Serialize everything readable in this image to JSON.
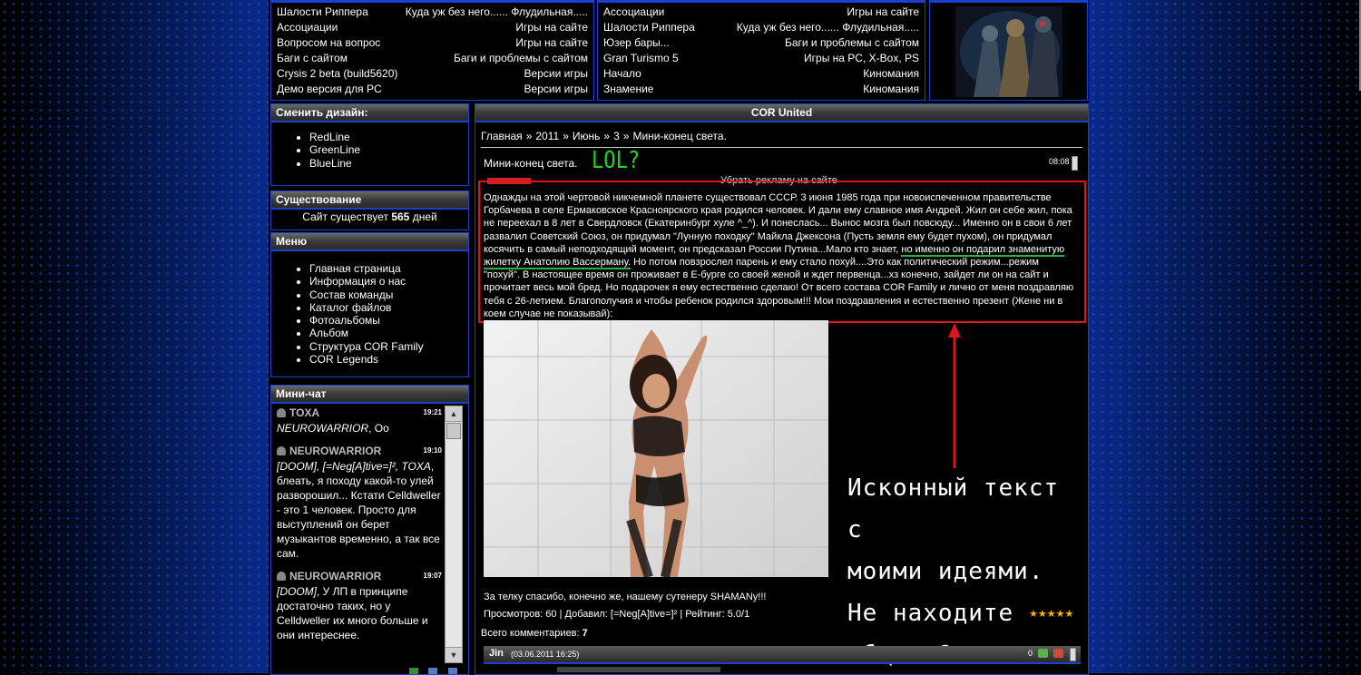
{
  "top_left_box": {
    "rows": [
      {
        "left": "Шалости Риппера",
        "right": "Куда уж без него...... Флудильная....."
      },
      {
        "left": "Ассоциации",
        "right": "Игры на сайте"
      },
      {
        "left": "Вопросом на вопрос",
        "right": "Игры на сайте"
      },
      {
        "left": "Баги с сайтом",
        "right": "Баги и проблемы с сайтом"
      },
      {
        "left": "Crysis 2 beta (build5620)",
        "right": "Версии игры"
      },
      {
        "left": "Демо версия для PC",
        "right": "Версии игры"
      }
    ]
  },
  "top_mid_box": {
    "rows": [
      {
        "left": "Ассоциации",
        "right": "Игры на сайте"
      },
      {
        "left": "Шалости Риппера",
        "right": "Куда уж без него...... Флудильная....."
      },
      {
        "left": "Юзер бары...",
        "right": "Баги и проблемы с сайтом"
      },
      {
        "left": "Gran Turismo 5",
        "right": "Игры на PC, X-Box, PS"
      },
      {
        "left": "Начало",
        "right": "Киномания"
      },
      {
        "left": "Знамение",
        "right": "Киномания"
      }
    ]
  },
  "design_box": {
    "title": "Сменить дизайн:",
    "items": [
      "RedLine",
      "GreenLine",
      "BlueLine"
    ]
  },
  "existence_box": {
    "title": "Существование",
    "prefix": "Сайт существует",
    "days": "565",
    "suffix": "дней"
  },
  "menu_box": {
    "title": "Меню",
    "items": [
      "Главная страница",
      "Информация о нас",
      "Состав команды",
      "Каталог файлов",
      "Фотоальбомы",
      "Альбом",
      "Структура COR Family",
      "COR Legends"
    ]
  },
  "chat_box": {
    "title": "Мини-чат",
    "messages": [
      {
        "name": "TOXA",
        "time": "19:21",
        "text_italic": "NEUROWARRIOR",
        "text": ", Оо"
      },
      {
        "name": "NEUROWARRIOR",
        "time": "19:10",
        "text_italic": "[DOOM], [=Neg[A]tive=]², TOXA",
        "text": ", блеать, я походу какой-то улей разворошил... Кстати Celldweller - это 1 человек. Просто для выступлений он берет музыкантов временно, а так все сам."
      },
      {
        "name": "NEUROWARRIOR",
        "time": "19:07",
        "text_italic": "[DOOM]",
        "text": ", У ЛП в принципе достаточно таких, но у Celldweller их много больше и они интереснее."
      }
    ]
  },
  "main": {
    "title": "COR United",
    "breadcrumb": [
      "Главная",
      "2011",
      "Июнь",
      "3",
      "Мини-конец света."
    ],
    "breadcrumb_sep": "»",
    "news_title": "Мини-конец света.",
    "news_time": "08:08",
    "annotation_lol": "LOL?",
    "ad_remove": "Убрать рекламу на сайте",
    "body_before": "Однажды на этой чертовой никчемной планете существовал СССР. 3 июня 1985 года при новоиспеченном правительстве Горбачева в селе Ермаковское Красноярского края родился человек. И дали ему славное имя Андрей. Жил он себе жил, пока не переехал в 8 лет в Свердловск (Екатеринбург хуле ^_^). И понеслась... Вынос мозга был повсюду... Именно он в свои 6 лет развалил Советский Союз, он придумал \"Лунную походку\" Майкла Джексона (Пусть земля ему будет пухом), он придумал косячить в самый неподходящий момент, он предсказал России Путина...Мало кто знает,",
    "body_underlined": "но именно он подарил знаменитую жилетку Анатолию Вассерману.",
    "body_after": "Но потом повзрослел парень и ему стало похуй....Это как политический режим...режим \"похуй\". В настоящее время он проживает в Е-бурге со своей женой и ждет первенца...хз конечно, зайдет ли он на сайт и прочитает весь мой бред. Но подарочек я ему естественно сделаю! От всего состава COR Family и лично от меня поздравляю тебя с 26-летием. Благополучия и чтобы ребенок родился здоровым!!! Мои поздравления и естественно презент (Жене ни в коем случае не показывай):",
    "annotation_lines": [
      "Исконный текст с",
      "моими идеями.",
      "Не находите общего?"
    ],
    "thanks": "За телку спасибо, конечно же, нашему сутенеру SHAMANу!!!",
    "stats": "Просмотров: 60 | Добавил: [=Neg[A]tive=]² | Рейтинг: 5.0/1",
    "comments_label": "Всего комментариев:",
    "comments_count": "7",
    "comment": {
      "author": "Jin",
      "date": "(03.06.2011 16:25)",
      "votes": "0"
    }
  }
}
